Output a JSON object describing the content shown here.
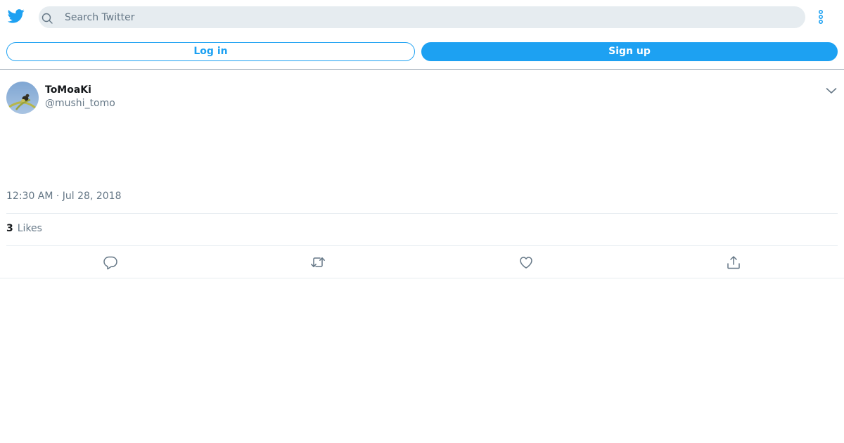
{
  "header": {
    "logo_icon": "twitter-bird-icon",
    "search": {
      "placeholder": "Search Twitter",
      "value": "",
      "icon": "search-icon"
    },
    "more_icon": "more-vertical-icon"
  },
  "auth": {
    "login_label": "Log in",
    "signup_label": "Sign up"
  },
  "tweet": {
    "author": {
      "name": "ToMoaKi",
      "handle": "@mushi_tomo",
      "avatar_icon": "avatar"
    },
    "menu_icon": "chevron-down-icon",
    "timestamp": "12:30 AM · Jul 28, 2018",
    "stats": {
      "likes_count": "3",
      "likes_label": "Likes"
    },
    "actions": [
      "reply-icon",
      "retweet-icon",
      "like-icon",
      "share-icon"
    ]
  },
  "colors": {
    "accent": "#1da1f2",
    "text_primary": "#14171a",
    "text_secondary": "#657786",
    "search_bg": "#e6ecf0",
    "divider": "#e6ecf0"
  }
}
